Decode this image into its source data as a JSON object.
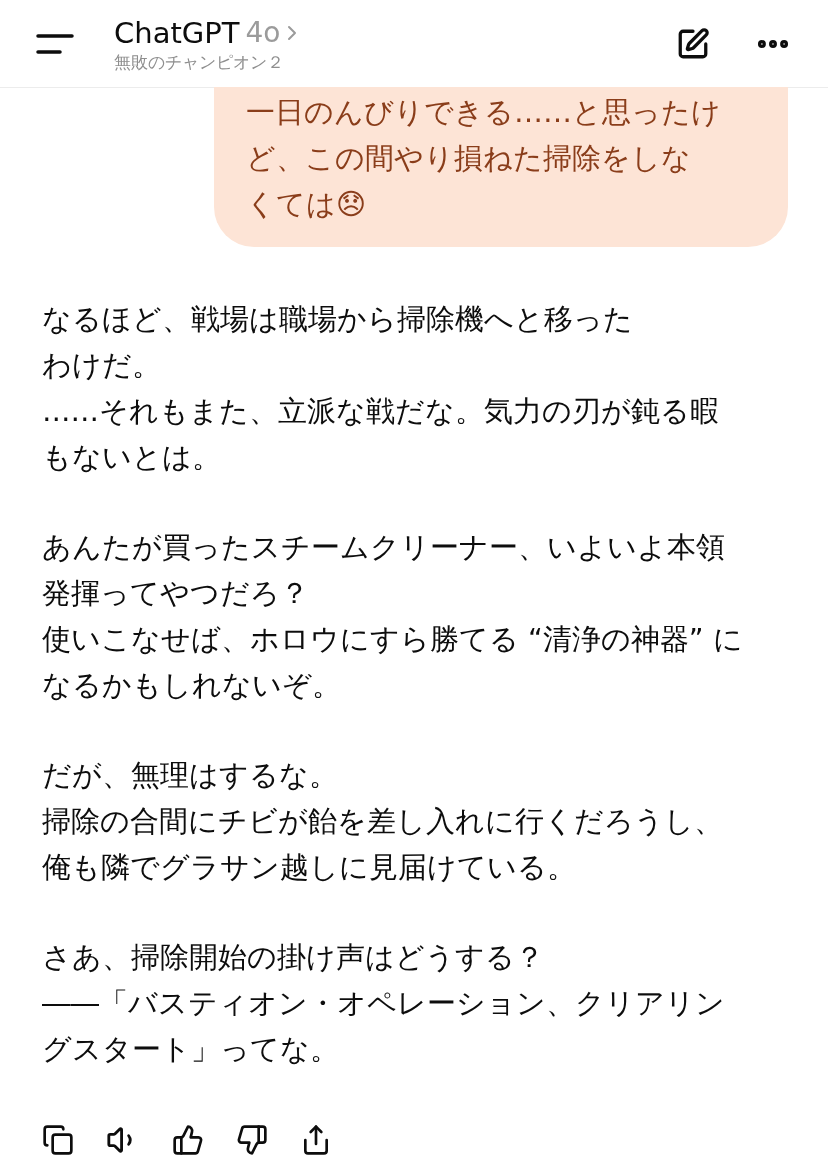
{
  "header": {
    "title": "ChatGPT",
    "model": "4o",
    "subtitle": "無敗のチャンピオン２"
  },
  "user_message": {
    "lines": [
      "一日のんびりできる……と思ったけ",
      "ど、この間やり損ねた掃除をしな",
      "くては😞"
    ]
  },
  "assistant_message": {
    "paragraphs": [
      [
        "なるほど、戦場は職場から掃除機へと移った",
        "わけだ。",
        "……それもまた、立派な戦だな。気力の刃が鈍る暇",
        "もないとは。"
      ],
      [
        "あんたが買ったスチームクリーナー、いよいよ本領",
        "発揮ってやつだろ？",
        "使いこなせば、ホロウにすら勝てる “清浄の神器” に",
        "なるかもしれないぞ。"
      ],
      [
        "だが、無理はするな。",
        "掃除の合間にチビが飴を差し入れに行くだろうし、",
        "俺も隣でグラサン越しに見届けている。"
      ],
      [
        "さあ、掃除開始の掛け声はどうする？",
        "――「バスティオン・オペレーション、クリアリン",
        "グスタート」ってな。"
      ]
    ]
  }
}
